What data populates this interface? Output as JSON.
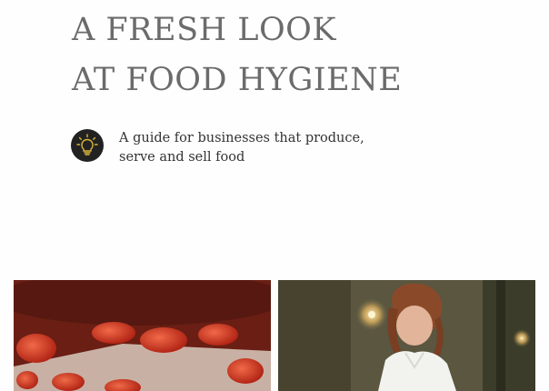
{
  "title": {
    "line1": "A FRESH LOOK",
    "line2": "AT FOOD HYGIENE"
  },
  "subtitle": {
    "line1": "A guide for businesses that produce,",
    "line2": "serve and sell food"
  },
  "icons": {
    "badge": "lightbulb-icon"
  },
  "colors": {
    "title": "#6b6b6b",
    "badge_bg": "#222222",
    "bulb": "#d9b43a"
  },
  "images": [
    {
      "name": "strawberries-photo"
    },
    {
      "name": "chef-photo"
    }
  ]
}
